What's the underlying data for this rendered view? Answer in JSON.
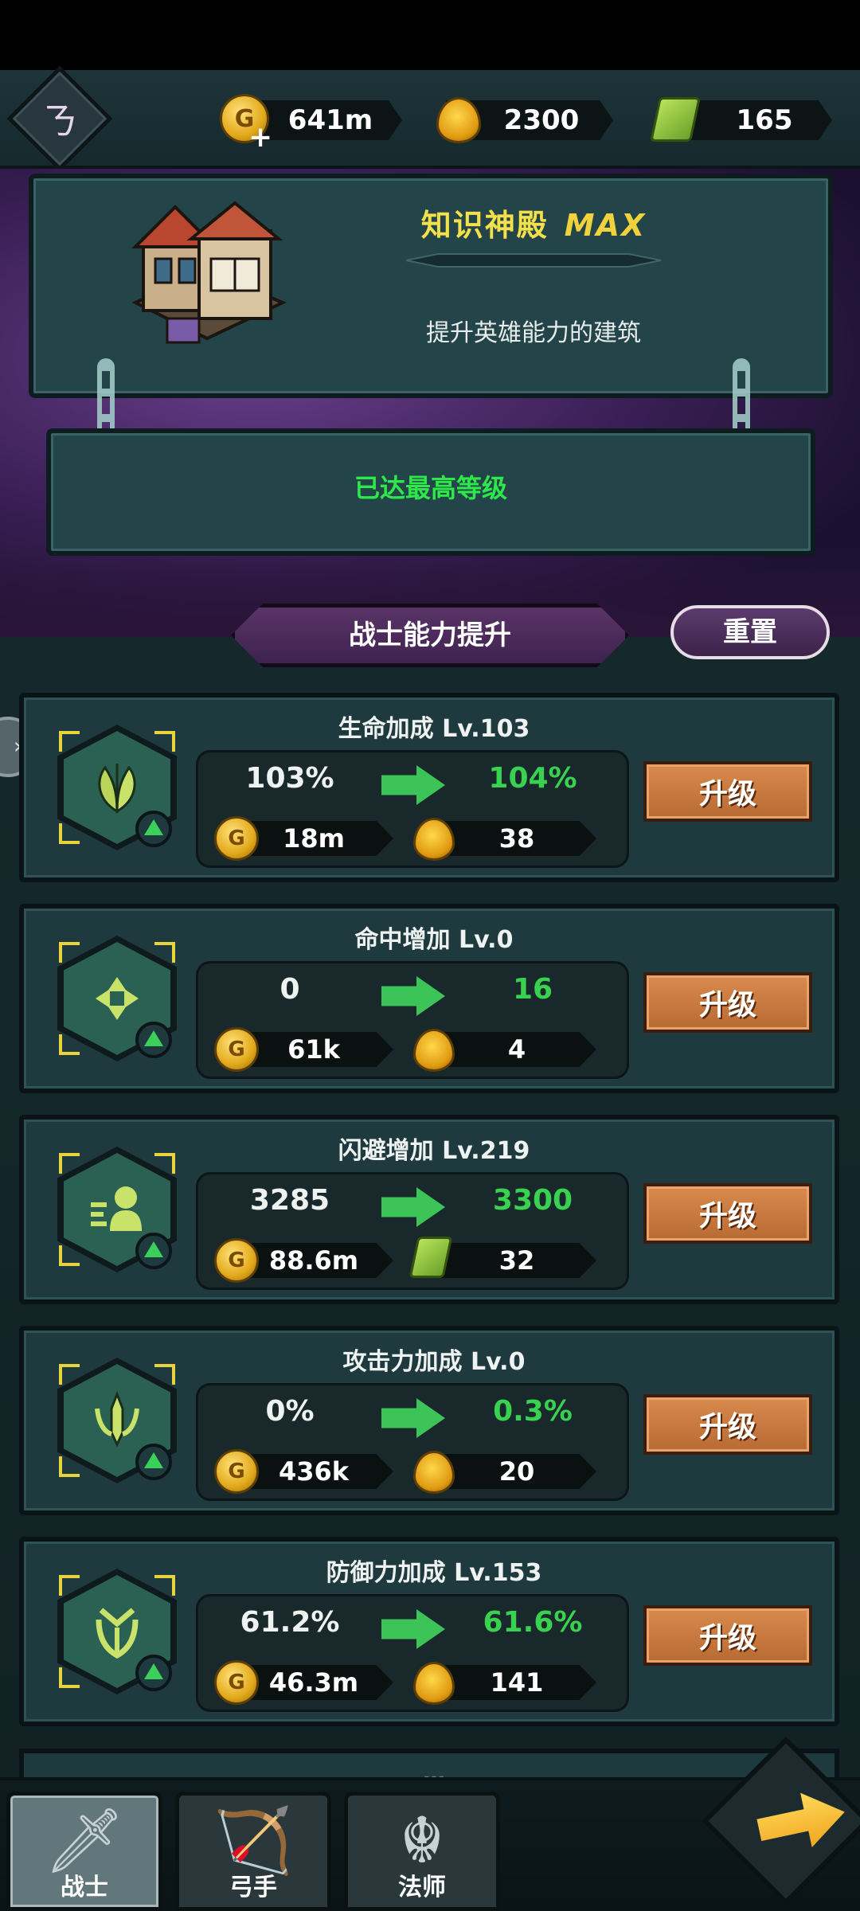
{
  "resources": {
    "gold": "641m",
    "drops": "2300",
    "scrolls": "165"
  },
  "building": {
    "name": "知识神殿",
    "level_tag": "MAX",
    "description": "提升英雄能力的建筑",
    "status": "已达最高等级"
  },
  "section": {
    "title": "战士能力提升",
    "reset_label": "重置"
  },
  "upgrades": [
    {
      "title": "生命加成 Lv.103",
      "current": "103%",
      "next": "104%",
      "gold_cost": "18m",
      "cost2": "38",
      "cost2_type": "drop",
      "button": "升级",
      "icon": "leaf-icon"
    },
    {
      "title": "命中增加 Lv.0",
      "current": "0",
      "next": "16",
      "gold_cost": "61k",
      "cost2": "4",
      "cost2_type": "drop",
      "button": "升级",
      "icon": "crosshair-icon"
    },
    {
      "title": "闪避增加 Lv.219",
      "current": "3285",
      "next": "3300",
      "gold_cost": "88.6m",
      "cost2": "32",
      "cost2_type": "scroll",
      "button": "升级",
      "icon": "dodge-person-icon"
    },
    {
      "title": "攻击力加成 Lv.0",
      "current": "0%",
      "next": "0.3%",
      "gold_cost": "436k",
      "cost2": "20",
      "cost2_type": "drop",
      "button": "升级",
      "icon": "sword-crest-icon"
    },
    {
      "title": "防御力加成 Lv.153",
      "current": "61.2%",
      "next": "61.6%",
      "gold_cost": "46.3m",
      "cost2": "141",
      "cost2_type": "drop",
      "button": "升级",
      "icon": "shield-crest-icon"
    }
  ],
  "bottom_nav": {
    "tabs": [
      {
        "label": "战士",
        "icon": "sword-icon"
      },
      {
        "label": "弓手",
        "icon": "bow-icon"
      },
      {
        "label": "法师",
        "icon": "mage-icon"
      }
    ]
  },
  "colors": {
    "accent_green": "#39d150",
    "title_yellow": "#f3e04a",
    "upgrade_orange": "#c97a40",
    "panel_teal": "#1e3a3f"
  }
}
